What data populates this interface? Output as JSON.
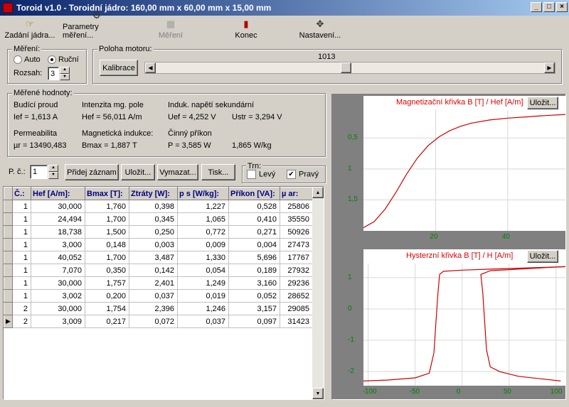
{
  "window": {
    "title": "Toroid v1.0 - Toroidní jádro:  160,00 mm x 60,00 mm x 15,00 mm",
    "minimize": "_",
    "maximize": "□",
    "close": "×"
  },
  "toolbar": [
    {
      "label": "Zadání jádra...",
      "icon": "core-entry-icon",
      "enabled": true
    },
    {
      "label": "Parametry měření...",
      "icon": "measurement-params-icon",
      "enabled": true
    },
    {
      "label": "Měření",
      "icon": "measure-icon",
      "enabled": false
    },
    {
      "label": "Konec",
      "icon": "exit-icon",
      "enabled": true
    },
    {
      "label": "Nastavení...",
      "icon": "settings-icon",
      "enabled": true
    }
  ],
  "mereni": {
    "title": "Měření:",
    "auto": "Auto",
    "manual": "Ruční",
    "selected": "Ruční",
    "rozsah_label": "Rozsah:",
    "rozsah_value": "3"
  },
  "motor": {
    "title": "Poloha motoru:",
    "calibrate": "Kalibrace",
    "value": "1013",
    "slider_fraction": 0.49
  },
  "measured": {
    "title": "Měřené hodnoty:",
    "budici_label": "Budící proud",
    "ief": "Ief =  1,613 A",
    "intenzita_label": "Intenzita mg. pole",
    "hef": "Hef =   56,011 A/m",
    "napeti_label": "Induk. napětí sekundární",
    "uef": "Uef = 4,252 V",
    "ustr": "Ustr =  3,294 V",
    "perm_label": "Permeabilita",
    "mur": "µr = 13490,483",
    "indukce_label": "Magnetická indukce:",
    "bmax": "Bmax = 1,887 T",
    "prikon_label": "Činný příkon",
    "p": "P = 3,585 W",
    "pw": "1,865 W/kg"
  },
  "controls": {
    "pc_label": "P. č.:",
    "pc_value": "1",
    "add": "Přidej záznam",
    "save": "Uložit...",
    "delete": "Vymazat...",
    "print": "Tisk...",
    "trn_title": "Trn:",
    "left": "Levý",
    "right": "Pravý",
    "left_checked": false,
    "right_checked": true
  },
  "table": {
    "headers": [
      "Č.:",
      "Hef [A/m]:",
      "Bmax [T]:",
      "Ztráty [W]:",
      "p s [W/kg]:",
      "Příkon [VA]:",
      "µ ar:"
    ],
    "rows": [
      [
        "1",
        "30,000",
        "1,760",
        "0,398",
        "1,227",
        "0,528",
        "25806"
      ],
      [
        "1",
        "24,494",
        "1,700",
        "0,345",
        "1,065",
        "0,410",
        "35550"
      ],
      [
        "1",
        "18,738",
        "1,500",
        "0,250",
        "0,772",
        "0,271",
        "50926"
      ],
      [
        "1",
        "3,000",
        "0,148",
        "0,003",
        "0,009",
        "0,004",
        "27473"
      ],
      [
        "1",
        "40,052",
        "1,700",
        "3,487",
        "1,330",
        "5,696",
        "17767"
      ],
      [
        "1",
        "7,070",
        "0,350",
        "0,142",
        "0,054",
        "0,189",
        "27932"
      ],
      [
        "1",
        "30,000",
        "1,757",
        "2,401",
        "1,249",
        "3,160",
        "29236"
      ],
      [
        "1",
        "3,002",
        "0,200",
        "0,037",
        "0,019",
        "0,052",
        "28652"
      ],
      [
        "2",
        "30,000",
        "1,754",
        "2,396",
        "1,246",
        "3,157",
        "29085"
      ],
      [
        "2",
        "3,009",
        "0,217",
        "0,072",
        "0,037",
        "0,097",
        "31423"
      ]
    ],
    "current_row": 9
  },
  "charts": {
    "mag": {
      "title": "Magnetizační křivka B [T] / Hef [A/m]",
      "save": "Uložit...",
      "yticks": [
        "1,5",
        "1",
        "0,5"
      ],
      "xticks": [
        "20",
        "40"
      ],
      "color": "#cc0000"
    },
    "hyst": {
      "title": "Hysterzní křivka B [T] / H [A/m]",
      "save": "Uložit...",
      "yticks": [
        "1",
        "0",
        "-1",
        "-2"
      ],
      "xticks": [
        "-100",
        "-50",
        "0",
        "50",
        "100"
      ],
      "color": "#cc0000"
    }
  },
  "chart_data": [
    {
      "type": "line",
      "title": "Magnetizační křivka B [T] / Hef [A/m]",
      "xlabel": "",
      "ylabel": "",
      "xlim": [
        0,
        56
      ],
      "ylim": [
        0,
        1.95
      ],
      "series": [
        {
          "x": [
            0,
            3,
            6,
            9,
            12,
            15,
            18,
            21,
            24,
            27,
            30,
            35,
            40,
            45,
            50,
            56
          ],
          "y": [
            0.05,
            0.15,
            0.35,
            0.62,
            0.92,
            1.18,
            1.38,
            1.52,
            1.62,
            1.69,
            1.74,
            1.79,
            1.82,
            1.84,
            1.86,
            1.88
          ]
        }
      ]
    },
    {
      "type": "line",
      "title": "Hysterzní křivka B [T] / H [A/m]",
      "xlabel": "",
      "ylabel": "",
      "xlim": [
        -105,
        110
      ],
      "ylim": [
        -2.45,
        1.45
      ],
      "series": [
        {
          "x": [
            -105,
            -80,
            -50,
            -35,
            -30,
            -28,
            -26,
            -24,
            -20,
            0,
            30,
            60,
            90,
            110
          ],
          "y": [
            -2.3,
            -2.27,
            -2.2,
            -2.05,
            -1.4,
            -0.5,
            0.4,
            1.1,
            1.2,
            1.24,
            1.27,
            1.3,
            1.33,
            1.35
          ]
        },
        {
          "x": [
            110,
            90,
            60,
            30,
            20,
            22,
            24,
            26,
            30,
            40,
            60,
            90,
            105
          ],
          "y": [
            1.35,
            1.32,
            1.27,
            1.22,
            1.1,
            0.5,
            -0.4,
            -1.3,
            -1.85,
            -2.0,
            -2.15,
            -2.25,
            -2.3
          ]
        }
      ]
    }
  ]
}
